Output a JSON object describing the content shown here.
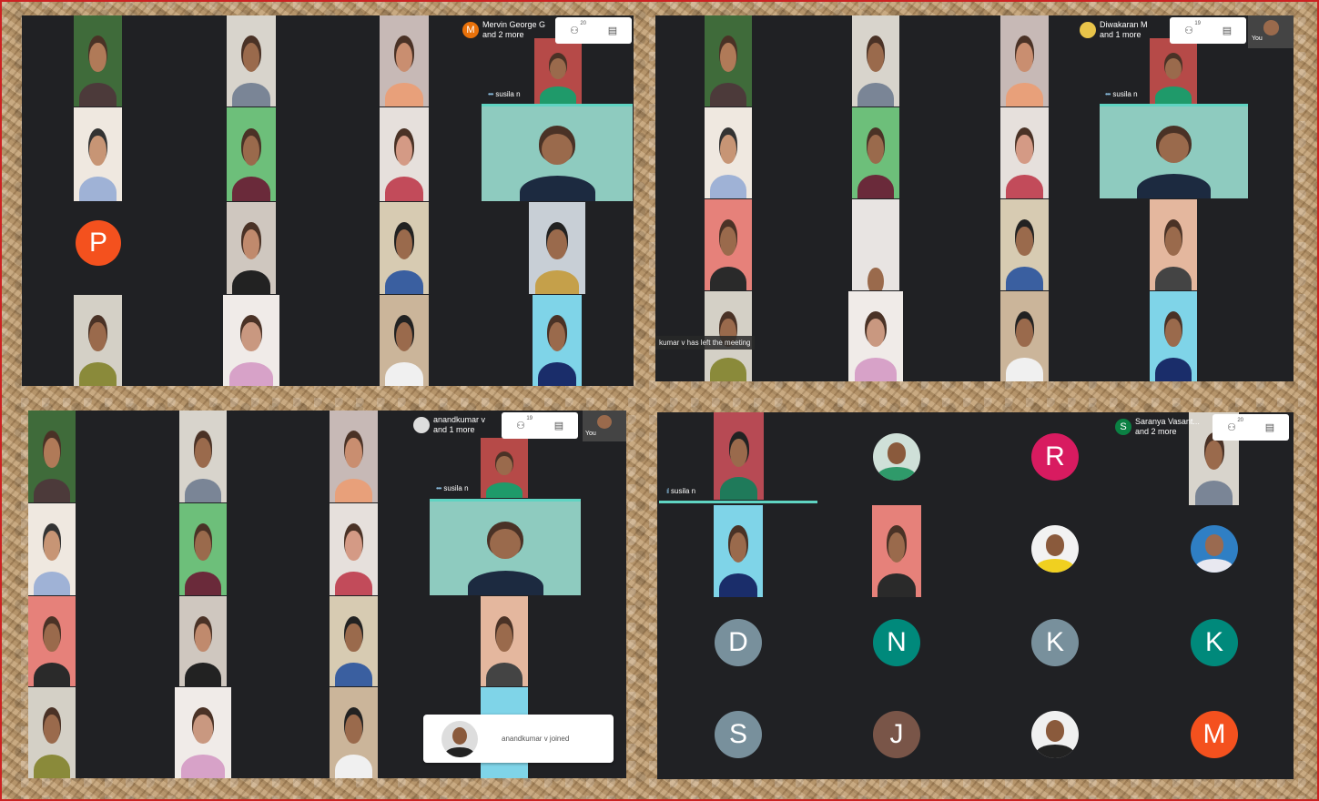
{
  "panels": [
    {
      "id": "top-left",
      "presenter_chip": {
        "initial": "M",
        "name": "Mervin George G",
        "more": "and 2 more",
        "color": "#e8710a"
      },
      "participants_count": "20",
      "speaker_label": "susila n",
      "avatar_letters": [
        "P"
      ],
      "avatar_colors": [
        "#f4511e"
      ]
    },
    {
      "id": "top-right",
      "presenter_chip": {
        "initial": "",
        "name": "Diwakaran M",
        "more": "and 1 more",
        "color": "#e8c44a"
      },
      "participants_count": "19",
      "speaker_label": "susila n",
      "notice": "kumar v has left the meeting",
      "self_label": "You"
    },
    {
      "id": "bottom-left",
      "presenter_chip": {
        "initial": "",
        "name": "anandkumar v",
        "more": "and 1 more",
        "color": "#ddd"
      },
      "participants_count": "19",
      "speaker_label": "susila n",
      "self_label": "You",
      "toast": "anandkumar v joined"
    },
    {
      "id": "bottom-right",
      "presenter_chip": {
        "initial": "S",
        "name": "Saranya Vasant...",
        "more": "and 2 more",
        "color": "#0b8043"
      },
      "participants_count": "20",
      "speaker_label": "susila n",
      "avatars": [
        {
          "letter": "R",
          "color": "#d81b60"
        },
        {
          "letter": "D",
          "color": "#78909c"
        },
        {
          "letter": "N",
          "color": "#00897b"
        },
        {
          "letter": "K",
          "color": "#78909c"
        },
        {
          "letter": "K",
          "color": "#00897b"
        },
        {
          "letter": "S",
          "color": "#78909c"
        },
        {
          "letter": "J",
          "color": "#795548"
        },
        {
          "letter": "M",
          "color": "#f4511e"
        }
      ]
    }
  ],
  "icons": {
    "people": "people-icon",
    "chat": "chat-icon"
  }
}
